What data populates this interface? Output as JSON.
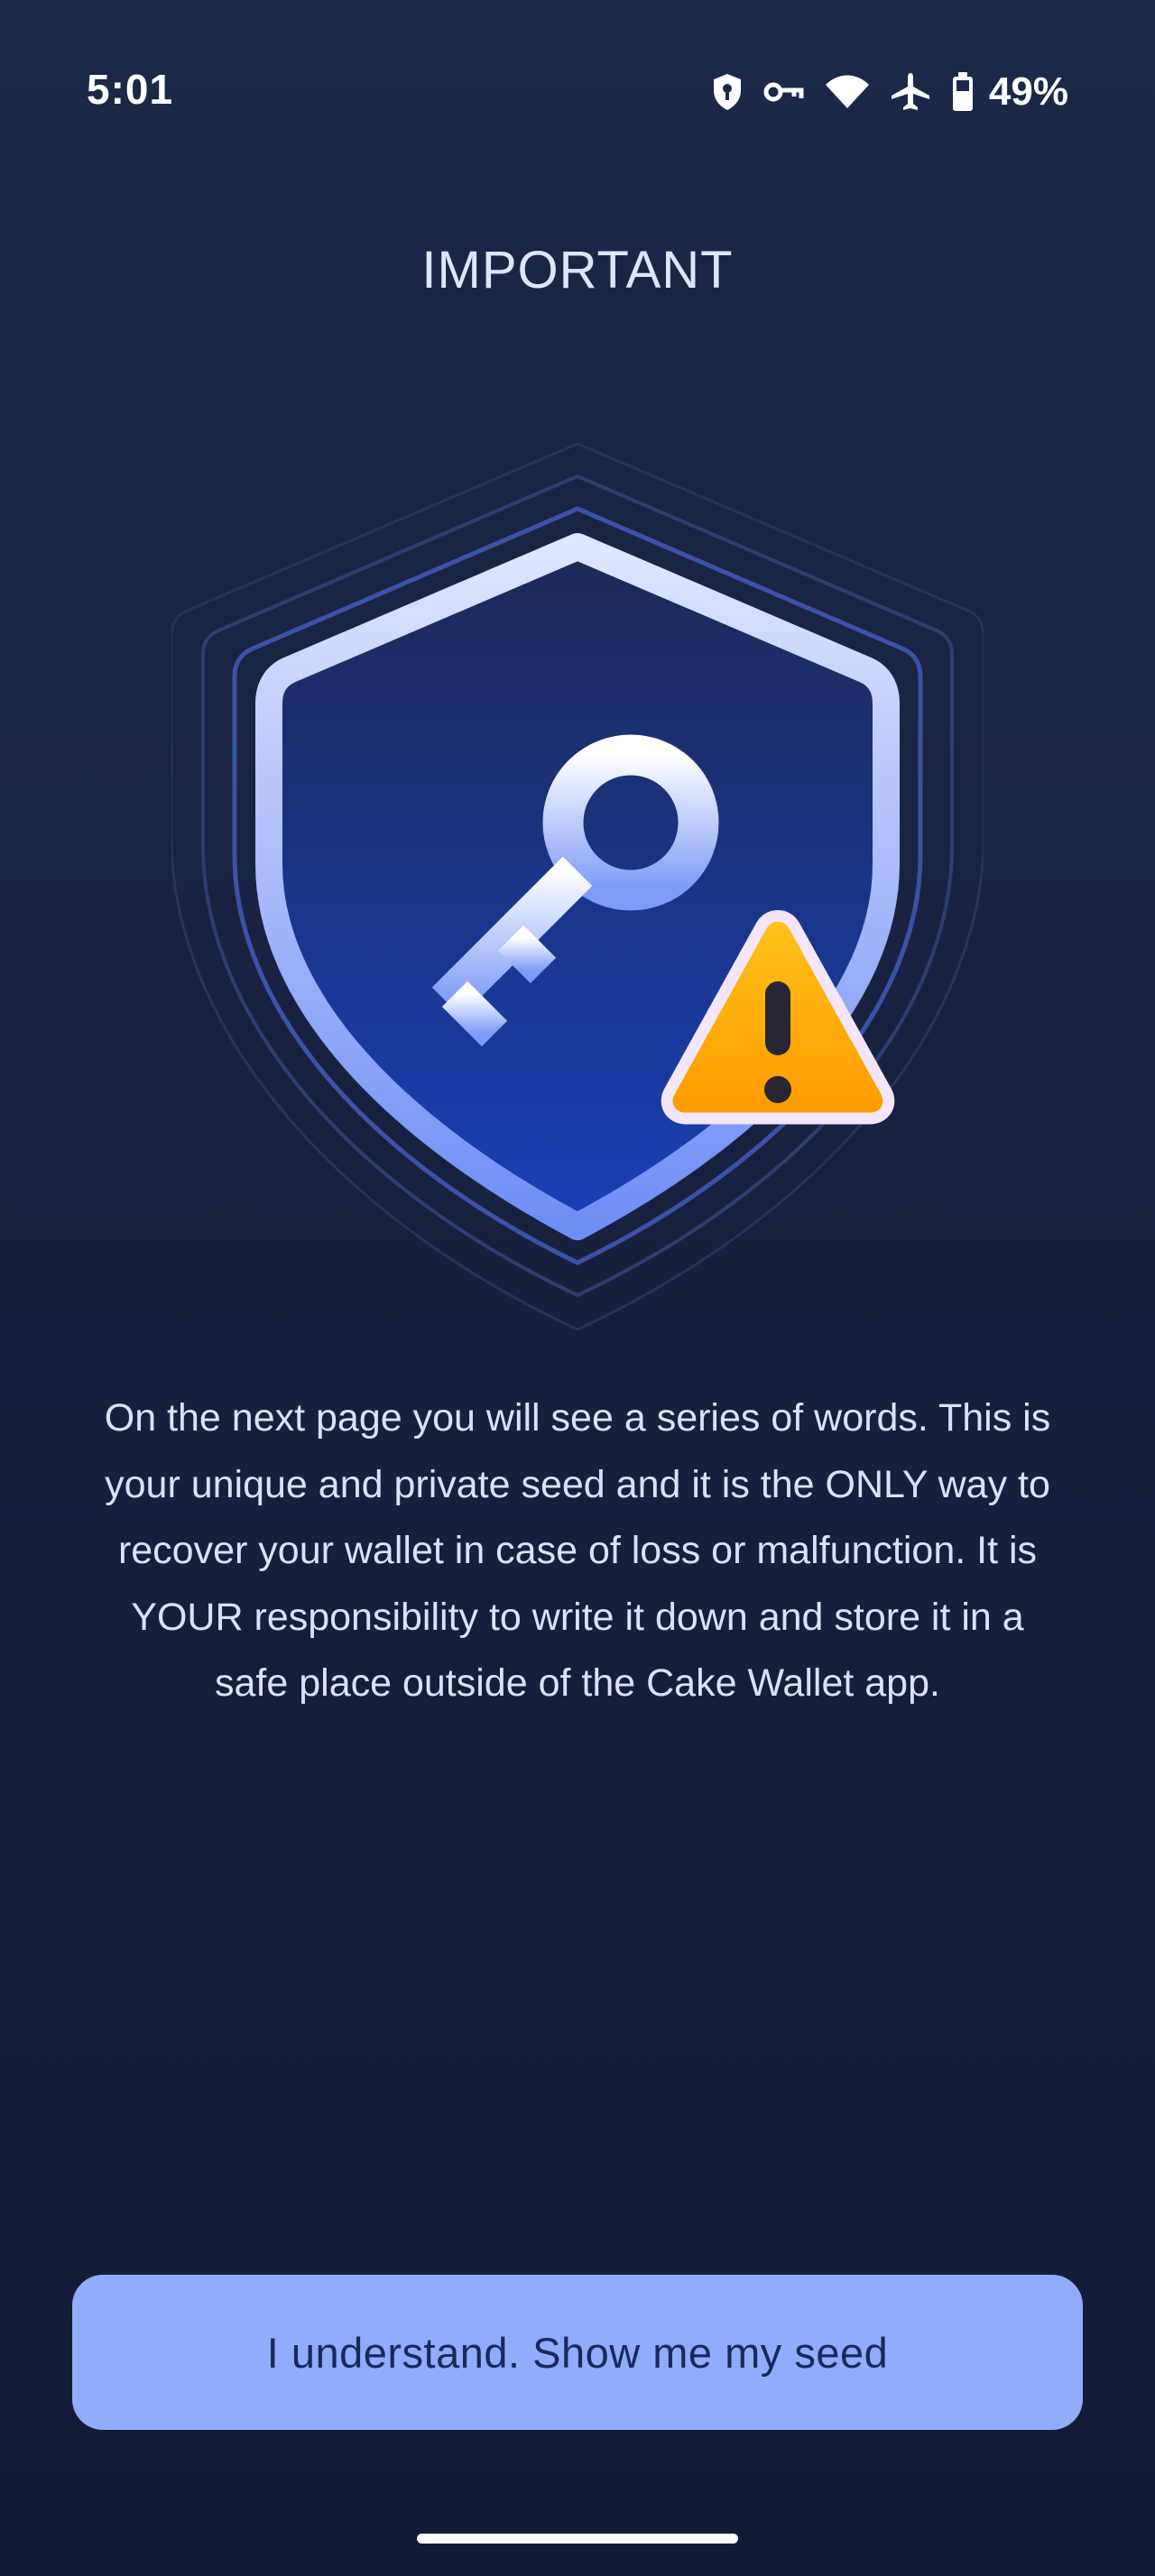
{
  "status_bar": {
    "time": "5:01",
    "icons": [
      "vpn-shield-icon",
      "vpn-key-icon",
      "wifi-icon",
      "airplane-mode-icon",
      "battery-icon"
    ],
    "battery_percent": "49%"
  },
  "page": {
    "title": "IMPORTANT",
    "illustration": {
      "icons": [
        "shield-icon",
        "key-icon",
        "warning-triangle-icon"
      ],
      "colors": {
        "shield_outline": "#8fa8f6",
        "shield_fill": "#1a3a9e",
        "warning_fill": "#ffb000",
        "warning_border": "#f4e6fb"
      }
    },
    "message": "On the next page you will see a series of words. This is your unique and private seed and it is the ONLY way to recover your wallet in case of loss or malfunction. It is YOUR responsibility to write it down and store it in a safe place outside of the Cake Wallet app."
  },
  "actions": {
    "confirm_label": "I understand. Show me my seed"
  },
  "colors": {
    "background": "#18213f",
    "button": "#91acfc",
    "button_text": "#19295a"
  }
}
